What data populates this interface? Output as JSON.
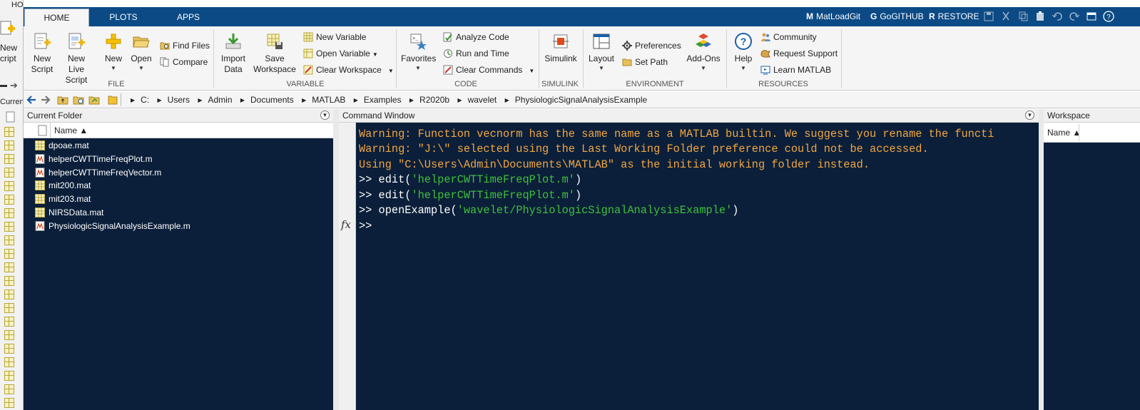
{
  "left_window": {
    "top_text": "HO",
    "new_script_lines": [
      "New",
      "cript"
    ],
    "current_label": "Current"
  },
  "tabs": [
    {
      "label": "HOME",
      "active": true
    },
    {
      "label": "PLOTS",
      "active": false
    },
    {
      "label": "APPS",
      "active": false
    }
  ],
  "quick_access": {
    "items": [
      {
        "letter": "M",
        "label": "MatLoadGit"
      },
      {
        "letter": "G",
        "label": "GoGITHUB"
      },
      {
        "letter": "R",
        "label": "RESTORE"
      }
    ]
  },
  "ribbon": {
    "file": {
      "group_label": "FILE",
      "new_script": [
        "New",
        "Script"
      ],
      "new_live_script": [
        "New",
        "Live Script"
      ],
      "new": "New",
      "open": "Open",
      "find_files": "Find Files",
      "compare": "Compare"
    },
    "variable": {
      "group_label": "VARIABLE",
      "import_data": [
        "Import",
        "Data"
      ],
      "save_workspace": [
        "Save",
        "Workspace"
      ],
      "new_variable": "New Variable",
      "open_variable": "Open Variable",
      "clear_workspace": "Clear Workspace"
    },
    "code": {
      "group_label": "CODE",
      "favorites": "Favorites",
      "analyze_code": "Analyze Code",
      "run_and_time": "Run and Time",
      "clear_commands": "Clear Commands"
    },
    "simulink": {
      "group_label": "SIMULINK",
      "simulink": "Simulink"
    },
    "environment": {
      "group_label": "ENVIRONMENT",
      "layout": "Layout",
      "preferences": "Preferences",
      "set_path": "Set Path",
      "add_ons": "Add-Ons"
    },
    "resources": {
      "group_label": "RESOURCES",
      "help": "Help",
      "community": "Community",
      "request_support": "Request Support",
      "learn_matlab": "Learn MATLAB"
    }
  },
  "address": {
    "crumbs": [
      "C:",
      "Users",
      "Admin",
      "Documents",
      "MATLAB",
      "Examples",
      "R2020b",
      "wavelet",
      "PhysiologicSignalAnalysisExample"
    ]
  },
  "current_folder": {
    "title": "Current Folder",
    "column_name": "Name ▲",
    "files": [
      {
        "name": "dpoae.mat",
        "type": "mat"
      },
      {
        "name": "helperCWTTimeFreqPlot.m",
        "type": "m"
      },
      {
        "name": "helperCWTTimeFreqVector.m",
        "type": "m"
      },
      {
        "name": "mit200.mat",
        "type": "mat"
      },
      {
        "name": "mit203.mat",
        "type": "mat"
      },
      {
        "name": "NIRSData.mat",
        "type": "mat"
      },
      {
        "name": "PhysiologicSignalAnalysisExample.m",
        "type": "m"
      }
    ]
  },
  "command_window": {
    "title": "Command Window",
    "warning1": "Warning: Function vecnorm has the same name as a MATLAB builtin. We suggest you rename the functi",
    "warning2": "Warning: \"J:\\\" selected using the Last Working Folder preference could not be accessed.",
    "warning3": "Using \"C:\\Users\\Admin\\Documents\\MATLAB\" as the initial working folder instead.",
    "cmd1_prefix": ">> edit(",
    "cmd1_arg": "'helperCWTTimeFreqPlot.m'",
    "cmd1_suffix": ")",
    "cmd2_prefix": ">> edit(",
    "cmd2_arg": "'helperCWTTimeFreqPlot.m'",
    "cmd2_suffix": ")",
    "cmd3_prefix": ">> openExample(",
    "cmd3_arg": "'wavelet/PhysiologicSignalAnalysisExample'",
    "cmd3_suffix": ")",
    "prompt": ">>",
    "fx_label": "fx"
  },
  "workspace": {
    "title": "Workspace",
    "column_name": "Name ▲"
  },
  "colors": {
    "title_bar": "#0b4a85",
    "panel_bg": "#0b1f3a",
    "warning_text": "#f2a641",
    "string_text": "#3fc03a"
  }
}
